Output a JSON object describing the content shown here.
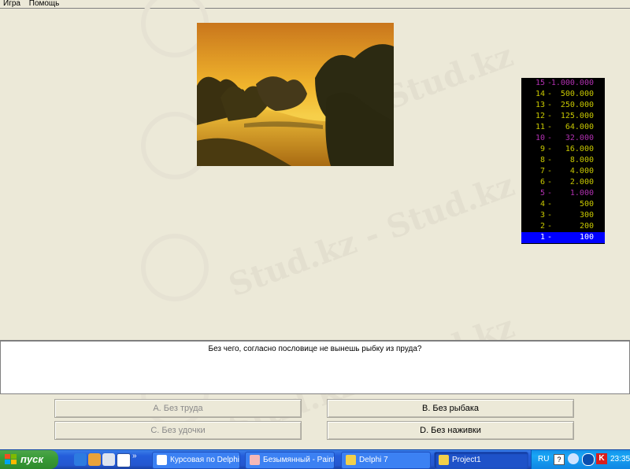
{
  "menu": {
    "items": [
      "Игра",
      "Помощь"
    ]
  },
  "watermark": {
    "text": "Stud.kz - Stud.kz"
  },
  "photo": {
    "description_icon": "sunset-river-photo"
  },
  "ladder": {
    "rungs": [
      {
        "level": "15",
        "amount": "1.000.000",
        "color": "#b030b0"
      },
      {
        "level": "14",
        "amount": "500.000",
        "color": "#c8c800"
      },
      {
        "level": "13",
        "amount": "250.000",
        "color": "#c8c800"
      },
      {
        "level": "12",
        "amount": "125.000",
        "color": "#c8c800"
      },
      {
        "level": "11",
        "amount": "64.000",
        "color": "#c8c800"
      },
      {
        "level": "10",
        "amount": "32.000",
        "color": "#b030b0"
      },
      {
        "level": "9",
        "amount": "16.000",
        "color": "#c8c800"
      },
      {
        "level": "8",
        "amount": "8.000",
        "color": "#c8c800"
      },
      {
        "level": "7",
        "amount": "4.000",
        "color": "#c8c800"
      },
      {
        "level": "6",
        "amount": "2.000",
        "color": "#c8c800"
      },
      {
        "level": "5",
        "amount": "1.000",
        "color": "#b030b0"
      },
      {
        "level": "4",
        "amount": "500",
        "color": "#c8c800"
      },
      {
        "level": "3",
        "amount": "300",
        "color": "#c8c800"
      },
      {
        "level": "2",
        "amount": "200",
        "color": "#c8c800"
      },
      {
        "level": "1",
        "amount": "100",
        "color": "#c8c800",
        "current": true
      }
    ]
  },
  "question": {
    "text": "Без чего, согласно пословице не вынешь рыбку из пруда?"
  },
  "answers": {
    "a": "A. Без труда",
    "b": "B. Без рыбака",
    "c": "C. Без удочки",
    "d": "D. Без наживки"
  },
  "taskbar": {
    "start_label": "пуск",
    "buttons": [
      "Курсовая по Delphi ...",
      "Безымянный - Paint",
      "Delphi 7",
      "Project1"
    ],
    "tray": {
      "lang": "RU",
      "time": "23:35"
    }
  },
  "colors": {
    "accent": "#0000ff",
    "face": "#ECE9D8",
    "taskbar": "#245edb"
  }
}
